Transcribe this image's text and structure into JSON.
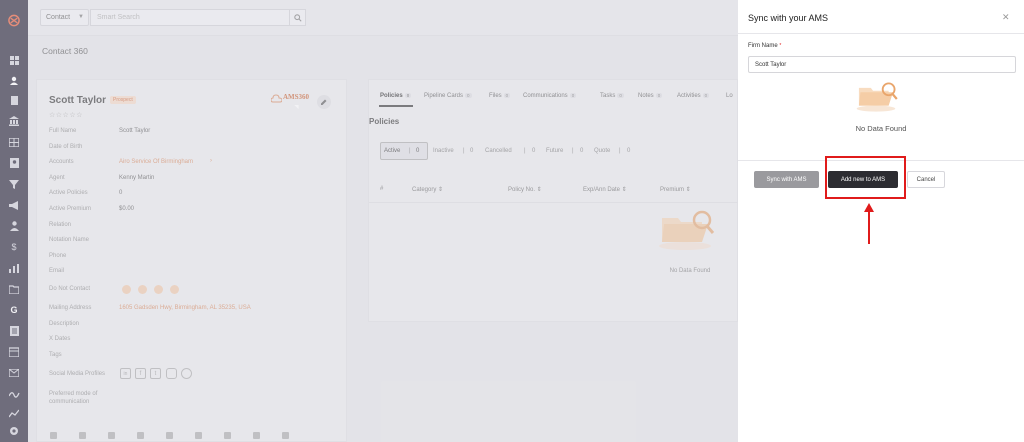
{
  "colors": {
    "accent": "#d7865a",
    "highlight": "#e01b1b",
    "sidebar": "#1e1a30",
    "primary_button": "#2c2c31"
  },
  "icons": [
    "logo-icon",
    "dashboard-icon",
    "contacts-icon",
    "documents-icon",
    "bank-icon",
    "table-icon",
    "contact-card-icon",
    "filter-icon",
    "megaphone-icon",
    "user-tie-icon",
    "dollar-icon",
    "analytics-icon",
    "folder-icon",
    "g-icon",
    "list-icon",
    "calendar-icon",
    "mail-icon",
    "signature-icon",
    "chart-icon",
    "settings-icon",
    "help-icon"
  ],
  "topbar": {
    "search_type": "Contact",
    "search_placeholder": "Smart Search"
  },
  "page": {
    "title": "Contact 360"
  },
  "contact": {
    "name": "Scott Taylor",
    "badge": "Prospect",
    "ams_label": "AMS360",
    "fields": [
      {
        "label": "Full Name",
        "value": "Scott Taylor"
      },
      {
        "label": "Date of Birth",
        "value": ""
      },
      {
        "label": "Accounts",
        "value": "Airo Service Of Birmingham"
      },
      {
        "label": "Agent",
        "value": "Kenny Martin"
      },
      {
        "label": "Active Policies",
        "value": "0"
      },
      {
        "label": "Active Premium",
        "value": "$0.00"
      },
      {
        "label": "Relation",
        "value": ""
      },
      {
        "label": "Notation Name",
        "value": ""
      },
      {
        "label": "Phone",
        "value": ""
      },
      {
        "label": "Email",
        "value": ""
      },
      {
        "label": "Do Not Contact",
        "value": ""
      },
      {
        "label": "Mailing Address",
        "value": "1605 Gadsden Hwy, Birmingham, AL 35235, USA"
      },
      {
        "label": "Description",
        "value": ""
      },
      {
        "label": "X Dates",
        "value": ""
      },
      {
        "label": "Tags",
        "value": ""
      },
      {
        "label": "Social Media Profiles",
        "value": ""
      },
      {
        "label": "Preferred mode of communication",
        "value": ""
      }
    ]
  },
  "tabs": [
    {
      "label": "Policies",
      "count": "0"
    },
    {
      "label": "Pipeline Cards",
      "count": "0"
    },
    {
      "label": "Files",
      "count": "0"
    },
    {
      "label": "Communications",
      "count": "0"
    },
    {
      "label": "Tasks",
      "count": "0"
    },
    {
      "label": "Notes",
      "count": "0"
    },
    {
      "label": "Activities",
      "count": "0"
    },
    {
      "label": "Lo",
      "count": ""
    }
  ],
  "policies": {
    "title": "Policies",
    "filters": [
      {
        "label": "Active",
        "count": "0"
      },
      {
        "label": "Inactive",
        "count": "0"
      },
      {
        "label": "Cancelled",
        "count": "0"
      },
      {
        "label": "Future",
        "count": "0"
      },
      {
        "label": "Quote",
        "count": "0"
      }
    ],
    "columns": [
      "#",
      "Category",
      "Policy No.",
      "Exp/Ann Date",
      "Premium"
    ],
    "empty_text": "No Data Found"
  },
  "panel": {
    "title": "Sync with your AMS",
    "field_label": "Firm Name",
    "required_mark": "*",
    "firm_name_value": "Scott Taylor",
    "empty_text": "No Data Found",
    "sync_button": "Sync with AMS",
    "add_button": "Add new to AMS",
    "cancel_button": "Cancel"
  }
}
